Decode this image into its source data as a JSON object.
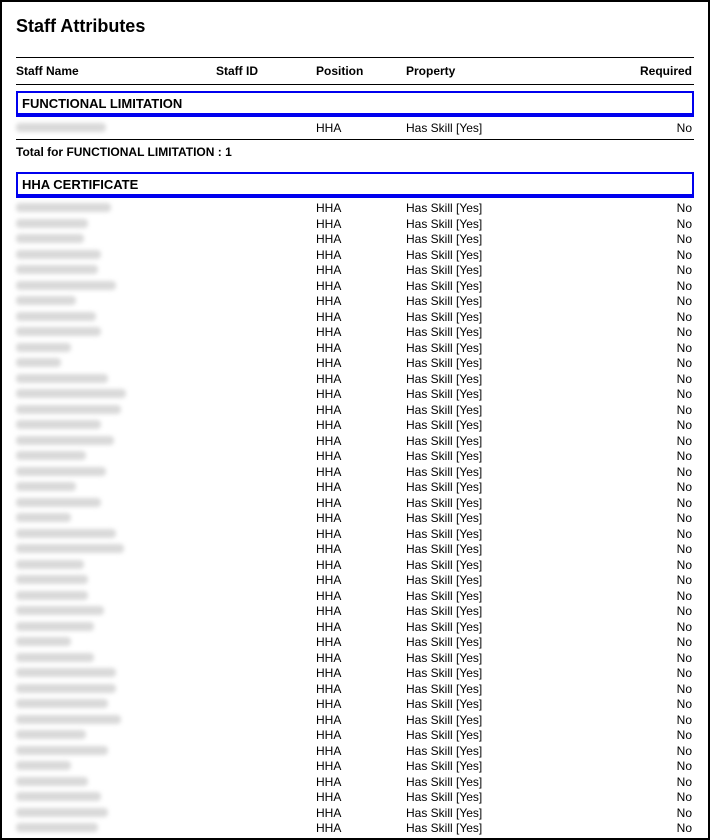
{
  "title": "Staff Attributes",
  "columns": {
    "name": "Staff Name",
    "id": "Staff ID",
    "position": "Position",
    "property": "Property",
    "required": "Required"
  },
  "groups": [
    {
      "label": "FUNCTIONAL LIMITATION",
      "rows": [
        {
          "name_width": 90,
          "position": "HHA",
          "property": "Has Skill [Yes]",
          "required": "No"
        }
      ],
      "total_label": "Total for FUNCTIONAL LIMITATION : 1"
    },
    {
      "label": "HHA CERTIFICATE",
      "rows": [
        {
          "name_width": 95,
          "position": "HHA",
          "property": "Has Skill [Yes]",
          "required": "No"
        },
        {
          "name_width": 72,
          "position": "HHA",
          "property": "Has Skill [Yes]",
          "required": "No"
        },
        {
          "name_width": 68,
          "position": "HHA",
          "property": "Has Skill [Yes]",
          "required": "No"
        },
        {
          "name_width": 85,
          "position": "HHA",
          "property": "Has Skill [Yes]",
          "required": "No"
        },
        {
          "name_width": 82,
          "position": "HHA",
          "property": "Has Skill [Yes]",
          "required": "No"
        },
        {
          "name_width": 100,
          "position": "HHA",
          "property": "Has Skill [Yes]",
          "required": "No"
        },
        {
          "name_width": 60,
          "position": "HHA",
          "property": "Has Skill [Yes]",
          "required": "No"
        },
        {
          "name_width": 80,
          "position": "HHA",
          "property": "Has Skill [Yes]",
          "required": "No"
        },
        {
          "name_width": 85,
          "position": "HHA",
          "property": "Has Skill [Yes]",
          "required": "No"
        },
        {
          "name_width": 55,
          "position": "HHA",
          "property": "Has Skill [Yes]",
          "required": "No"
        },
        {
          "name_width": 45,
          "position": "HHA",
          "property": "Has Skill [Yes]",
          "required": "No"
        },
        {
          "name_width": 92,
          "position": "HHA",
          "property": "Has Skill [Yes]",
          "required": "No"
        },
        {
          "name_width": 110,
          "position": "HHA",
          "property": "Has Skill [Yes]",
          "required": "No"
        },
        {
          "name_width": 105,
          "position": "HHA",
          "property": "Has Skill [Yes]",
          "required": "No"
        },
        {
          "name_width": 85,
          "position": "HHA",
          "property": "Has Skill [Yes]",
          "required": "No"
        },
        {
          "name_width": 98,
          "position": "HHA",
          "property": "Has Skill [Yes]",
          "required": "No"
        },
        {
          "name_width": 70,
          "position": "HHA",
          "property": "Has Skill [Yes]",
          "required": "No"
        },
        {
          "name_width": 90,
          "position": "HHA",
          "property": "Has Skill [Yes]",
          "required": "No"
        },
        {
          "name_width": 60,
          "position": "HHA",
          "property": "Has Skill [Yes]",
          "required": "No"
        },
        {
          "name_width": 85,
          "position": "HHA",
          "property": "Has Skill [Yes]",
          "required": "No"
        },
        {
          "name_width": 55,
          "position": "HHA",
          "property": "Has Skill [Yes]",
          "required": "No"
        },
        {
          "name_width": 100,
          "position": "HHA",
          "property": "Has Skill [Yes]",
          "required": "No"
        },
        {
          "name_width": 108,
          "position": "HHA",
          "property": "Has Skill [Yes]",
          "required": "No"
        },
        {
          "name_width": 68,
          "position": "HHA",
          "property": "Has Skill [Yes]",
          "required": "No"
        },
        {
          "name_width": 72,
          "position": "HHA",
          "property": "Has Skill [Yes]",
          "required": "No"
        },
        {
          "name_width": 72,
          "position": "HHA",
          "property": "Has Skill [Yes]",
          "required": "No"
        },
        {
          "name_width": 88,
          "position": "HHA",
          "property": "Has Skill [Yes]",
          "required": "No"
        },
        {
          "name_width": 78,
          "position": "HHA",
          "property": "Has Skill [Yes]",
          "required": "No"
        },
        {
          "name_width": 55,
          "position": "HHA",
          "property": "Has Skill [Yes]",
          "required": "No"
        },
        {
          "name_width": 78,
          "position": "HHA",
          "property": "Has Skill [Yes]",
          "required": "No"
        },
        {
          "name_width": 100,
          "position": "HHA",
          "property": "Has Skill [Yes]",
          "required": "No"
        },
        {
          "name_width": 100,
          "position": "HHA",
          "property": "Has Skill [Yes]",
          "required": "No"
        },
        {
          "name_width": 92,
          "position": "HHA",
          "property": "Has Skill [Yes]",
          "required": "No"
        },
        {
          "name_width": 105,
          "position": "HHA",
          "property": "Has Skill [Yes]",
          "required": "No"
        },
        {
          "name_width": 70,
          "position": "HHA",
          "property": "Has Skill [Yes]",
          "required": "No"
        },
        {
          "name_width": 92,
          "position": "HHA",
          "property": "Has Skill [Yes]",
          "required": "No"
        },
        {
          "name_width": 55,
          "position": "HHA",
          "property": "Has Skill [Yes]",
          "required": "No"
        },
        {
          "name_width": 72,
          "position": "HHA",
          "property": "Has Skill [Yes]",
          "required": "No"
        },
        {
          "name_width": 85,
          "position": "HHA",
          "property": "Has Skill [Yes]",
          "required": "No"
        },
        {
          "name_width": 92,
          "position": "HHA",
          "property": "Has Skill [Yes]",
          "required": "No"
        },
        {
          "name_width": 82,
          "position": "HHA",
          "property": "Has Skill [Yes]",
          "required": "No"
        }
      ],
      "total_label": null
    }
  ]
}
